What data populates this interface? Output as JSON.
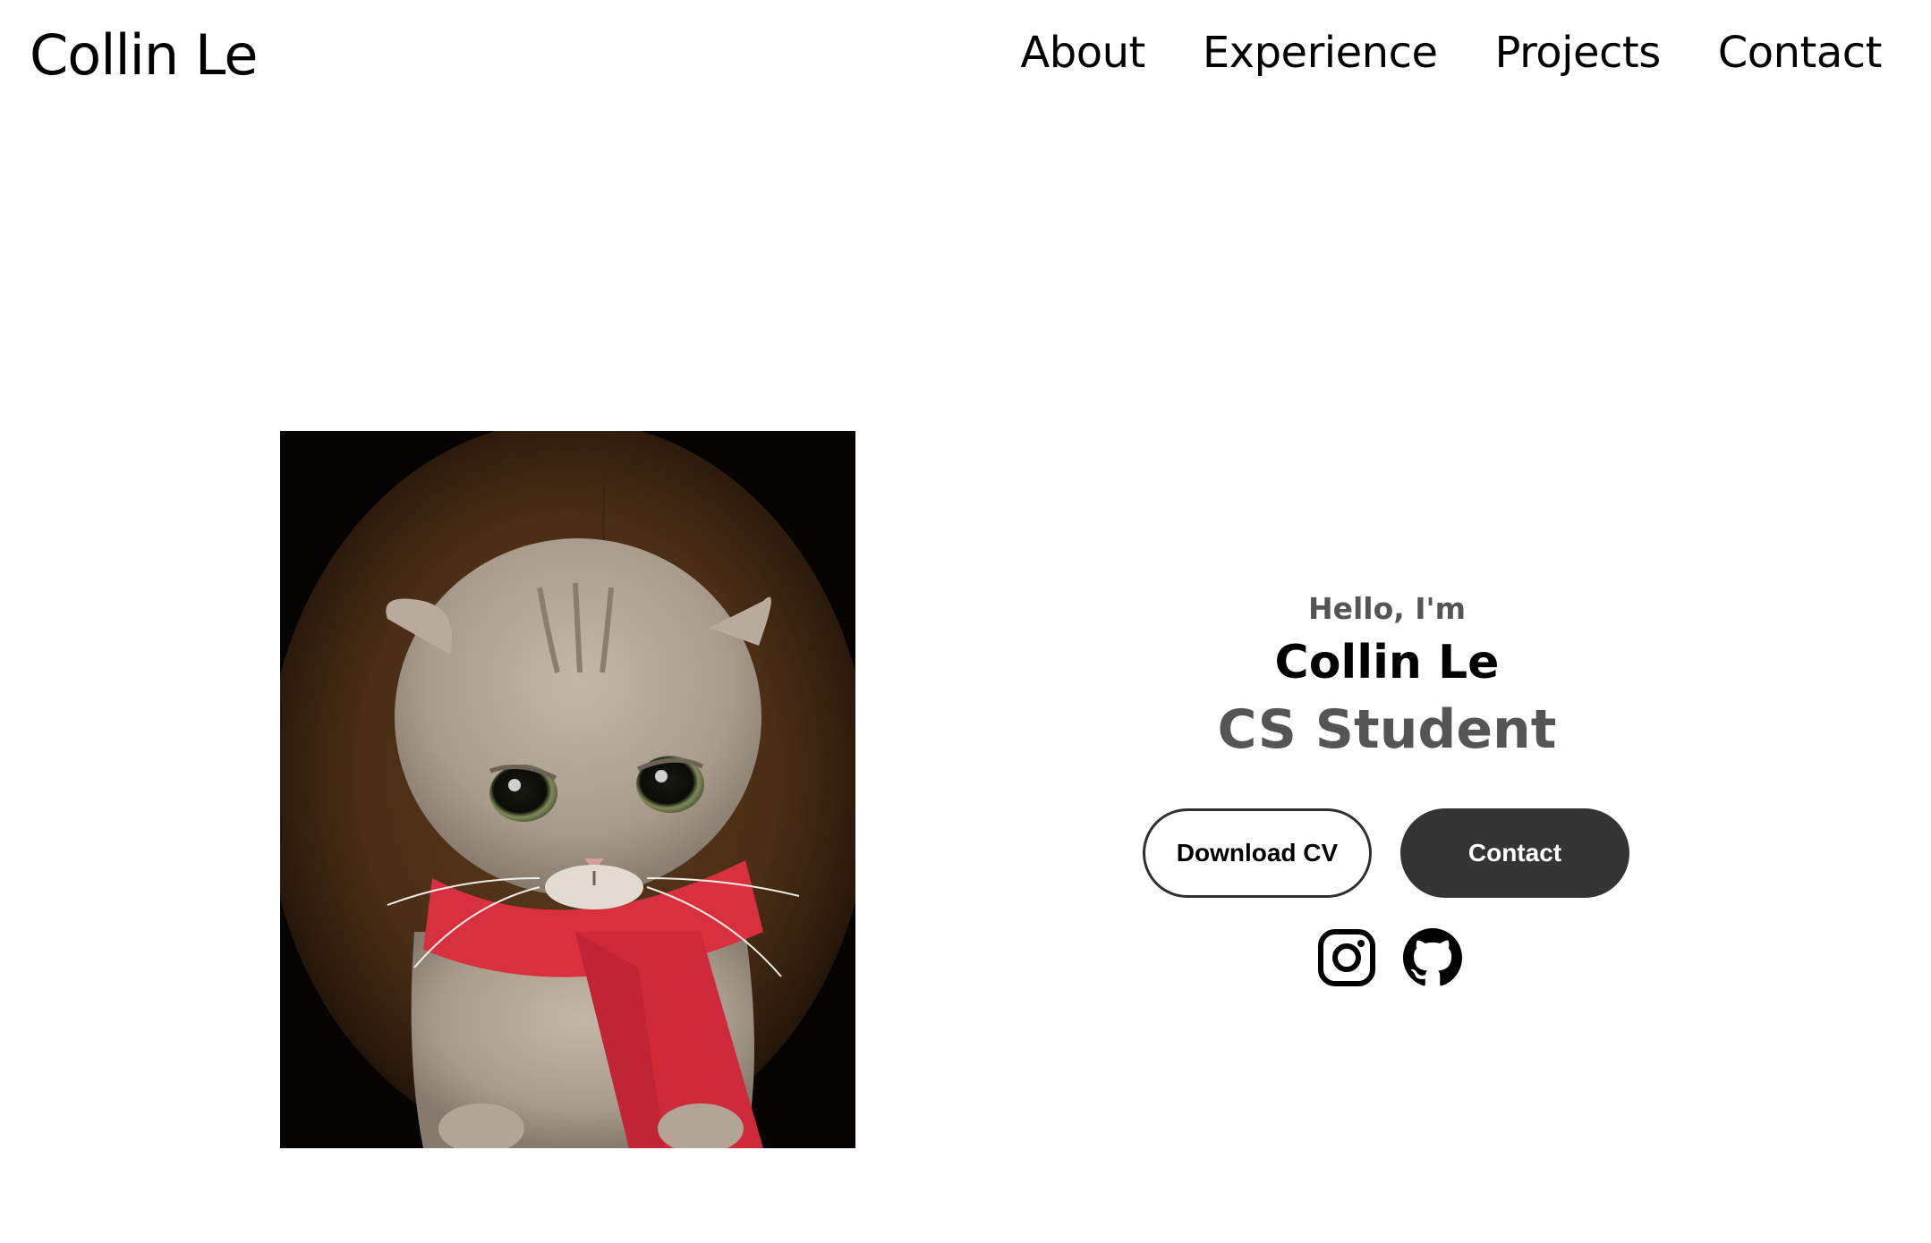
{
  "nav": {
    "logo": "Collin Le",
    "links": [
      "About",
      "Experience",
      "Projects",
      "Contact"
    ]
  },
  "hero": {
    "greeting": "Hello, I'm",
    "name": "Collin Le",
    "title": "CS Student",
    "buttons": {
      "download_cv": "Download CV",
      "contact": "Contact"
    },
    "profile_image_subject": "grey scottish fold cat wearing a red scarf",
    "socials": [
      "instagram-icon",
      "github-icon"
    ]
  },
  "colors": {
    "text": "#000000",
    "muted": "#555555",
    "button_dark": "#353535",
    "background": "#ffffff"
  }
}
